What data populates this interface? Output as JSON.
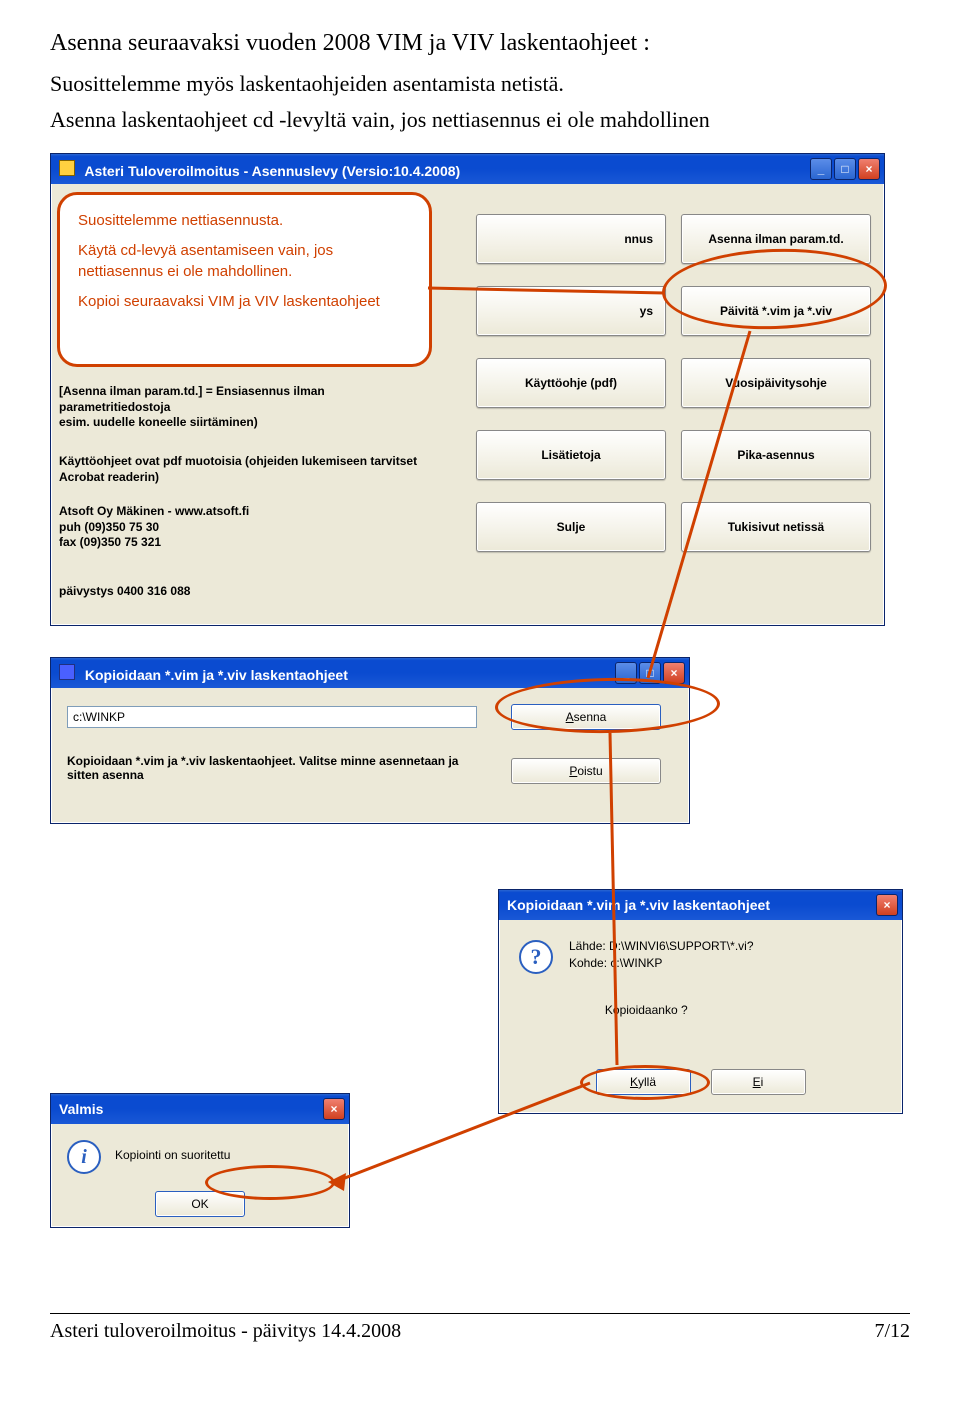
{
  "heading": "Asenna seuraavaksi vuoden 2008 VIM ja VIV laskentaohjeet :",
  "para1": "Suosittelemme myös laskentaohjeiden asentamista netistä.",
  "para2": "Asenna laskentaohjeet cd -levyltä vain, jos nettiasennus ei ole mahdollinen",
  "win1": {
    "title": "Asteri Tuloveroilmoitus - Asennuslevy (Versio:10.4.2008)",
    "callout": {
      "l1": "Suosittelemme nettiasennusta.",
      "l2": "Käytä cd-levyä asentamiseen vain, jos nettiasennus ei ole mahdollinen.",
      "l3": "Kopioi seuraavaksi VIM ja VIV laskentaohjeet"
    },
    "lt1": "[Asenna ilman param.td.] = Ensiasennus ilman parametritiedostoja\nesim. uudelle koneelle siirtäminen)",
    "lt2": "Käyttöohjeet ovat pdf muotoisia (ohjeiden lukemiseen tarvitset Acrobat readerin)",
    "lt3a": "Atsoft Oy Mäkinen - www.atsoft.fi",
    "lt3b": "puh (09)350 75 30",
    "lt3c": "fax (09)350 75 321",
    "lt4": "päivystys 0400 316 088",
    "col1": [
      "nnus",
      "ys",
      "Käyttöohje (pdf)",
      "Lisätietoja",
      "Sulje"
    ],
    "col2": [
      "Asenna ilman param.td.",
      "Päivitä *.vim ja *.viv",
      "Vuosipäivitysohje",
      "Pika-asennus",
      "Tukisivut netissä"
    ]
  },
  "win2": {
    "title": "Kopioidaan *.vim ja *.viv laskentaohjeet",
    "path": "c:\\WINKP",
    "b1_u": "A",
    "b1_rest": "senna",
    "b2_u": "P",
    "b2_rest": "oistu",
    "desc": "Kopioidaan *.vim ja *.viv laskentaohjeet. Valitse minne asennetaan ja sitten asenna"
  },
  "win3": {
    "title": "Kopioidaan *.vim ja *.viv laskentaohjeet",
    "l1": "Lähde: D:\\WINVI6\\SUPPORT\\*.vi?",
    "l2": "Kohde: c:\\WINKP",
    "l3": "Kopioidaanko ?",
    "yes_u": "K",
    "yes_rest": "yllä",
    "no_u": "E",
    "no_rest": "i"
  },
  "win4": {
    "title": "Valmis",
    "msg": "Kopiointi on suoritettu",
    "ok": "OK"
  },
  "footer_left": "Asteri tuloveroilmoitus - päivitys 14.4.2008",
  "footer_right": "7/12"
}
